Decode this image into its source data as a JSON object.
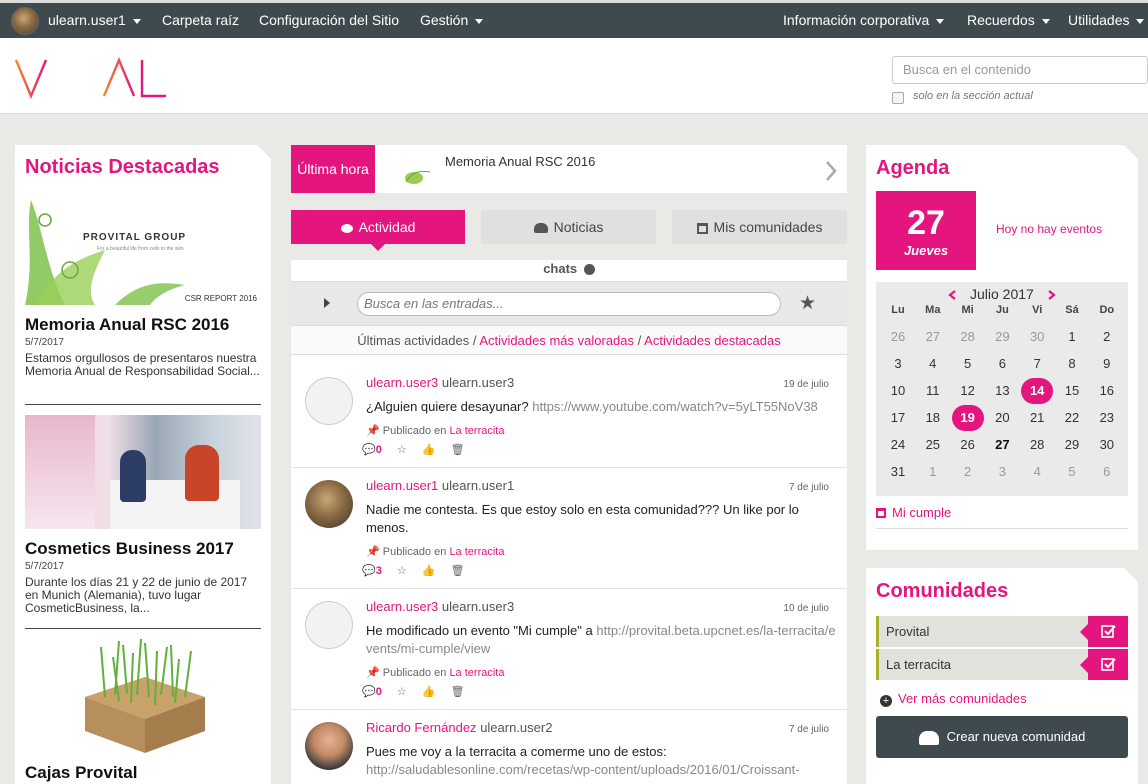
{
  "topbar": {
    "user": "ulearn.user1",
    "items_left": [
      "Carpeta raíz",
      "Configuración del Sitio",
      "Gestión"
    ],
    "items_right": [
      "Información corporativa",
      "Recuerdos",
      "Utilidades"
    ]
  },
  "header": {
    "logo": "VITAL",
    "search_placeholder": "Busca en el contenido",
    "only_section_label": "solo en la sección actual"
  },
  "news": {
    "title": "Noticias Destacadas",
    "items": [
      {
        "title": "Memoria Anual RSC 2016",
        "date": "5/7/2017",
        "desc": "Estamos orgullosos de presentaros nuestra Memoria Anual de Responsabilidad Social..."
      },
      {
        "title": "Cosmetics Business 2017",
        "date": "5/7/2017",
        "desc": "Durante los días 21 y 22 de junio de 2017 en Munich (Alemania), tuvo lugar CosmeticBusiness, la..."
      },
      {
        "title": "Cajas Provital",
        "date": "",
        "desc": ""
      }
    ],
    "csr_brand": "PROVITAL GROUP",
    "csr_tag": "For a beautiful life from cells to the skin",
    "csr_report": "CSR REPORT 2016"
  },
  "breaking": {
    "label": "Última hora",
    "item": "Memoria Anual RSC 2016"
  },
  "tabs": [
    "Actividad",
    "Noticias",
    "Mis comunidades"
  ],
  "feed": {
    "chats_label": "chats",
    "search_placeholder": "Busca en las entradas...",
    "filters": [
      "Últimas actividades",
      "Actividades más valoradas",
      "Actividades destacadas"
    ],
    "posts": [
      {
        "user": "ulearn.user3",
        "handle": "ulearn.user3",
        "date": "19 de julio",
        "text": "¿Alguien quiere desayunar?",
        "link": "https://www.youtube.com/watch?v=5yLT55NoV38",
        "published_label": "Publicado en",
        "community": "La terracita",
        "comments": "0"
      },
      {
        "user": "ulearn.user1",
        "handle": "ulearn.user1",
        "date": "7 de julio",
        "text": "Nadie me contesta. Es que estoy solo en esta comunidad??? Un like por lo menos.",
        "link": "",
        "published_label": "Publicado en",
        "community": "La terracita",
        "comments": "3"
      },
      {
        "user": "ulearn.user3",
        "handle": "ulearn.user3",
        "date": "10 de julio",
        "text": "He modificado un evento \"Mi cumple\" a",
        "link": "http://provital.beta.upcnet.es/la-terracita/events/mi-cumple/view",
        "published_label": "Publicado en",
        "community": "La terracita",
        "comments": "0"
      },
      {
        "user": "Ricardo Fernández",
        "handle": "ulearn.user2",
        "date": "7 de julio",
        "text": "Pues me voy a la terracita a comerme uno de estos:",
        "link": "http://saludablesonline.com/recetas/wp-content/uploads/2016/01/Croissant-",
        "published_label": "",
        "community": "",
        "comments": ""
      }
    ]
  },
  "agenda": {
    "title": "Agenda",
    "day": "27",
    "weekday": "Jueves",
    "no_events": "Hoy no hay eventos",
    "month": "Julio 2017",
    "weekdays": [
      "Lu",
      "Ma",
      "Mi",
      "Ju",
      "Vi",
      "Sá",
      "Do"
    ],
    "weeks": [
      [
        "26",
        "27",
        "28",
        "29",
        "30",
        "1",
        "2"
      ],
      [
        "3",
        "4",
        "5",
        "6",
        "7",
        "8",
        "9"
      ],
      [
        "10",
        "11",
        "12",
        "13",
        "14",
        "15",
        "16"
      ],
      [
        "17",
        "18",
        "19",
        "20",
        "21",
        "22",
        "23"
      ],
      [
        "24",
        "25",
        "26",
        "27",
        "28",
        "29",
        "30"
      ],
      [
        "31",
        "1",
        "2",
        "3",
        "4",
        "5",
        "6"
      ]
    ],
    "event": "Mi cumple"
  },
  "communities": {
    "title": "Comunidades",
    "items": [
      "Provital",
      "La terracita"
    ],
    "more": "Ver más comunidades",
    "create": "Crear nueva comunidad"
  },
  "colors": {
    "accent": "#e5157f",
    "topbar": "#3f4a4f",
    "community_border": "#a8b02c"
  }
}
